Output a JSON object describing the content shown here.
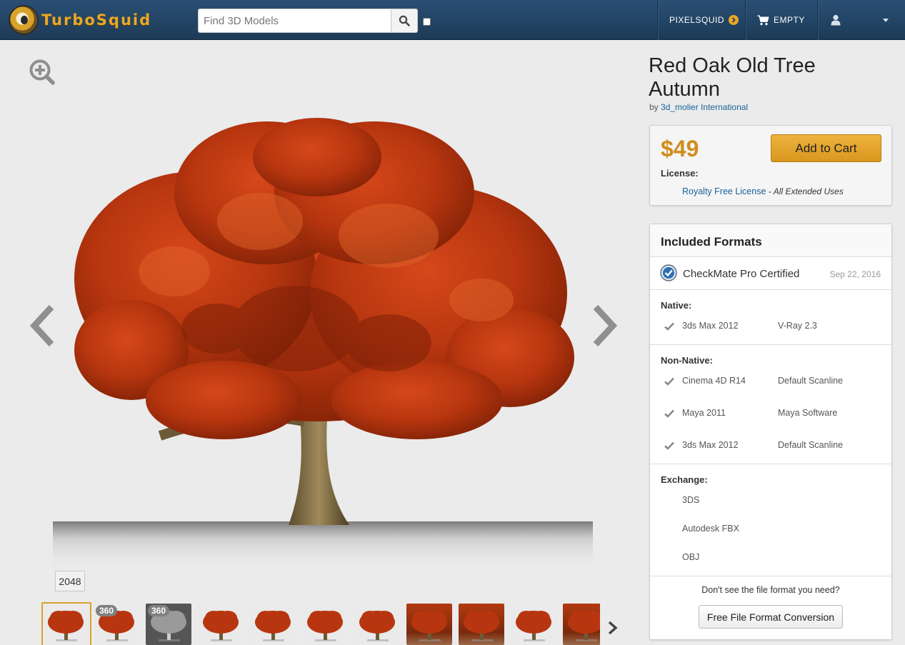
{
  "header": {
    "logo_text": "TurboSquid",
    "search": {
      "placeholder": "Find 3D Models",
      "value": ""
    },
    "pixelsquid_label": "PIXELSQUID",
    "cart_label": "EMPTY"
  },
  "viewer": {
    "resolution_badge": "2048",
    "thumbnails": [
      {
        "badge": "",
        "style": "tree",
        "selected": true
      },
      {
        "badge": "360",
        "style": "tree"
      },
      {
        "badge": "360",
        "style": "dark"
      },
      {
        "badge": "",
        "style": "tree"
      },
      {
        "badge": "",
        "style": "tree"
      },
      {
        "badge": "",
        "style": "tree"
      },
      {
        "badge": "",
        "style": "tree"
      },
      {
        "badge": "",
        "style": "warm"
      },
      {
        "badge": "",
        "style": "warm"
      },
      {
        "badge": "",
        "style": "tree"
      },
      {
        "badge": "",
        "style": "warm"
      }
    ]
  },
  "product": {
    "title": "Red Oak Old Tree Autumn",
    "by_prefix": "by",
    "author": "3d_molier International",
    "price": "$49",
    "add_to_cart_label": "Add to Cart",
    "license_label": "License:",
    "license_name": "Royalty Free License",
    "license_uses": "- All Extended Uses"
  },
  "formats": {
    "heading": "Included Formats",
    "checkmate_label": "CheckMate Pro Certified",
    "checkmate_date": "Sep 22, 2016",
    "native": {
      "title": "Native:",
      "rows": [
        {
          "name": "3ds Max 2012",
          "renderer": "V-Ray 2.3"
        }
      ]
    },
    "non_native": {
      "title": "Non-Native:",
      "rows": [
        {
          "name": "Cinema 4D R14",
          "renderer": "Default Scanline"
        },
        {
          "name": "Maya 2011",
          "renderer": "Maya Software"
        },
        {
          "name": "3ds Max 2012",
          "renderer": "Default Scanline"
        }
      ]
    },
    "exchange": {
      "title": "Exchange:",
      "rows": [
        {
          "name": "3DS"
        },
        {
          "name": "Autodesk FBX"
        },
        {
          "name": "OBJ"
        }
      ]
    },
    "conversion_question": "Don't see the file format you need?",
    "conversion_button": "Free File Format Conversion"
  },
  "colors": {
    "nav_bg": "#23476b",
    "accent_gold": "#d9971e",
    "link_blue": "#18629b",
    "foliage": "#b8360f"
  }
}
